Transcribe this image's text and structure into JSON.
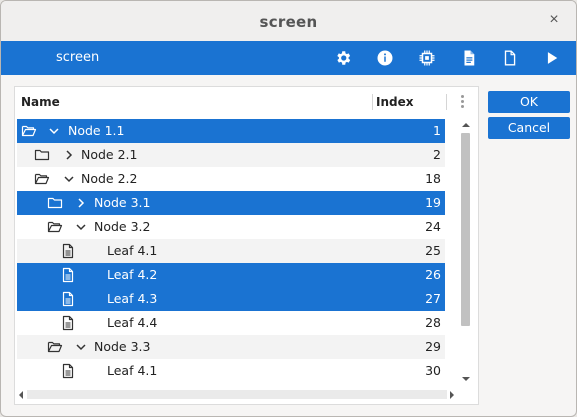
{
  "window": {
    "title": "screen",
    "close_glyph": "×"
  },
  "toolbar": {
    "title": "screen",
    "icons": [
      "gear-icon",
      "info-icon",
      "chip-icon",
      "document-text-icon",
      "document-blank-icon",
      "play-icon"
    ]
  },
  "tree": {
    "columns": {
      "name": "Name",
      "index": "Index"
    },
    "rows": [
      {
        "label": "Node 1.1",
        "index": "1",
        "type": "folder-open",
        "expanded": true,
        "depth": 0,
        "selected": true
      },
      {
        "label": "Node 2.1",
        "index": "2",
        "type": "folder",
        "expanded": false,
        "depth": 1,
        "selected": false
      },
      {
        "label": "Node 2.2",
        "index": "18",
        "type": "folder-open",
        "expanded": true,
        "depth": 1,
        "selected": false
      },
      {
        "label": "Node 3.1",
        "index": "19",
        "type": "folder",
        "expanded": false,
        "depth": 2,
        "selected": true
      },
      {
        "label": "Node 3.2",
        "index": "24",
        "type": "folder-open",
        "expanded": true,
        "depth": 2,
        "selected": false
      },
      {
        "label": "Leaf 4.1",
        "index": "25",
        "type": "leaf",
        "depth": 3,
        "selected": false
      },
      {
        "label": "Leaf 4.2",
        "index": "26",
        "type": "leaf",
        "depth": 3,
        "selected": true
      },
      {
        "label": "Leaf 4.3",
        "index": "27",
        "type": "leaf",
        "depth": 3,
        "selected": true
      },
      {
        "label": "Leaf 4.4",
        "index": "28",
        "type": "leaf",
        "depth": 3,
        "selected": false
      },
      {
        "label": "Node 3.3",
        "index": "29",
        "type": "folder-open",
        "expanded": true,
        "depth": 2,
        "selected": false
      },
      {
        "label": "Leaf 4.1",
        "index": "30",
        "type": "leaf",
        "depth": 3,
        "selected": false
      }
    ]
  },
  "buttons": {
    "ok": "OK",
    "cancel": "Cancel"
  },
  "colors": {
    "accent": "#1a73d2",
    "selection_text": "#ffffff"
  }
}
